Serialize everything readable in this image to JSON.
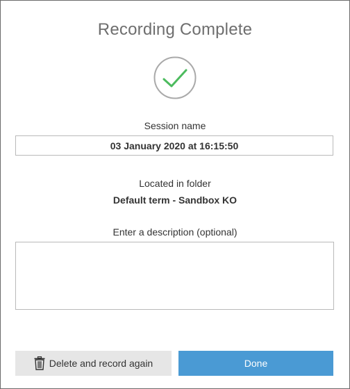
{
  "dialog": {
    "title": "Recording Complete",
    "status_icon": "checkmark-circle-icon",
    "session_label": "Session name",
    "session_name": "03 January 2020 at 16:15:50",
    "folder_label": "Located in folder",
    "folder_name": "Default term - Sandbox KO",
    "description_label": "Enter a description (optional)",
    "description_value": ""
  },
  "buttons": {
    "delete_icon": "trash-icon",
    "delete_label": "Delete and record again",
    "done_label": "Done"
  },
  "colors": {
    "accent": "#4a9ad4",
    "check_green": "#4cbb5e",
    "title_gray": "#6e6e6e"
  }
}
